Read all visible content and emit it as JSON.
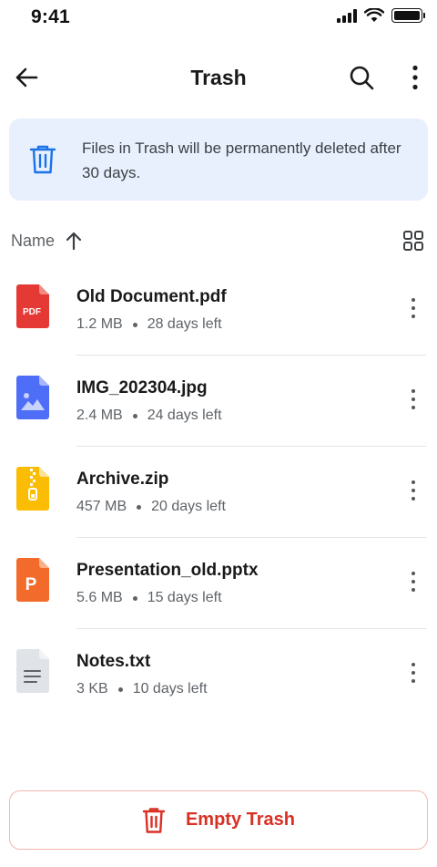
{
  "status_bar": {
    "time": "9:41"
  },
  "app_bar": {
    "title": "Trash"
  },
  "banner": {
    "text": "Files in Trash will be permanently deleted after 30 days."
  },
  "sort": {
    "label": "Name"
  },
  "files": [
    {
      "name": "Old Document.pdf",
      "size": "1.2 MB",
      "days_left": "28 days left",
      "icon": "pdf-file-icon",
      "badge": "PDF"
    },
    {
      "name": "IMG_202304.jpg",
      "size": "2.4 MB",
      "days_left": "24 days left",
      "icon": "image-file-icon"
    },
    {
      "name": "Archive.zip",
      "size": "457 MB",
      "days_left": "20 days left",
      "icon": "zip-file-icon"
    },
    {
      "name": "Presentation_old.pptx",
      "size": "5.6 MB",
      "days_left": "15 days left",
      "icon": "pptx-file-icon",
      "badge": "P"
    },
    {
      "name": "Notes.txt",
      "size": "3 KB",
      "days_left": "10 days left",
      "icon": "text-file-icon"
    }
  ],
  "empty_trash": {
    "label": "Empty Trash"
  },
  "colors": {
    "accent_blue": "#1a73e8",
    "banner_bg": "#e8f0fe",
    "danger": "#d93025",
    "pdf": "#e53935",
    "image": "#4f6ef7",
    "zip": "#fbbc04",
    "pptx": "#f26b2b",
    "text_file": "#dadce0"
  }
}
